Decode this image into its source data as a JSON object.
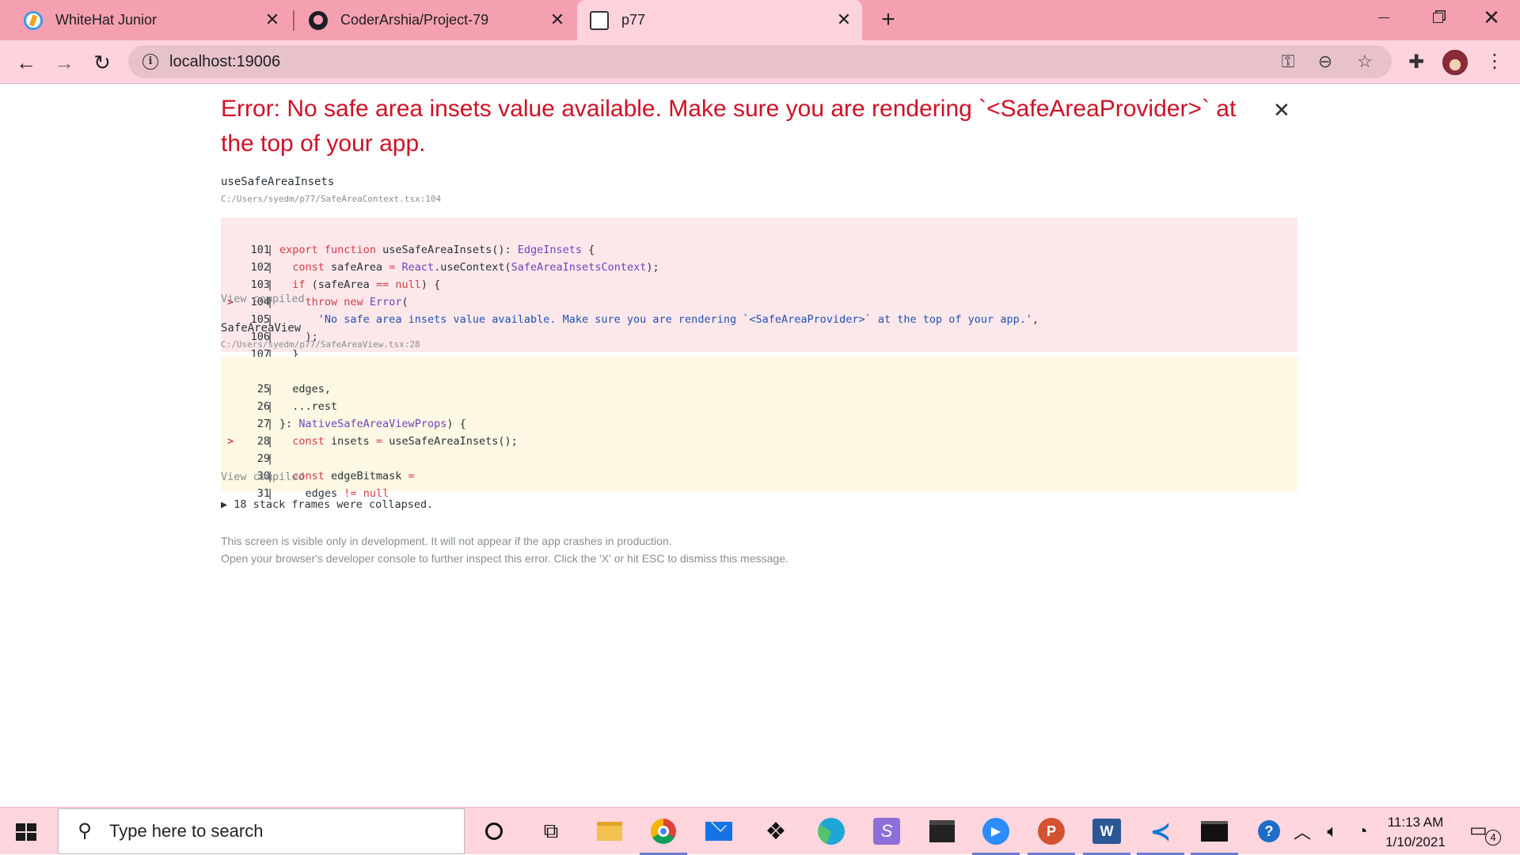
{
  "browser": {
    "tabs": [
      {
        "title": "WhiteHat Junior",
        "icon": "whitehat-favicon"
      },
      {
        "title": "CoderArshia/Project-79",
        "icon": "github-favicon"
      },
      {
        "title": "p77",
        "icon": "expo-favicon",
        "active": true
      }
    ],
    "url": "localhost:19006"
  },
  "error": {
    "title": "Error: No safe area insets value available. Make sure you are rendering `<SafeAreaProvider>` at the top of your app.",
    "frames": [
      {
        "name": "useSafeAreaInsets",
        "path": "C:/Users/syedm/p77/SafeAreaContext.tsx:104",
        "view_compiled": "View compiled"
      },
      {
        "name": "SafeAreaView",
        "path": "C:/Users/syedm/p77/SafeAreaView.tsx:28",
        "view_compiled": "View compiled"
      }
    ],
    "collapsed": "18 stack frames were collapsed.",
    "footnote_1": "This screen is visible only in development. It will not appear if the app crashes in production.",
    "footnote_2": "Open your browser's developer console to further inspect this error.  Click the 'X' or hit ESC to dismiss this message."
  },
  "code1": {
    "n101": "101",
    "n102": "102",
    "n103": "103",
    "n104": "104",
    "n105": "105",
    "n106": "106",
    "n107": "107"
  },
  "code2": {
    "n25": "25",
    "n26": "26",
    "n27": "27",
    "n28": "28",
    "n29": "29",
    "n30": "30",
    "n31": "31"
  },
  "taskbar": {
    "search_placeholder": "Type here to search",
    "time": "11:13 AM",
    "date": "1/10/2021",
    "notification_count": "4"
  },
  "colors": {
    "tab_bar": "#f5a0b1",
    "error_red": "#ce1126",
    "code_red_bg": "#fce8ea",
    "code_yellow_bg": "#fdf8e3"
  }
}
